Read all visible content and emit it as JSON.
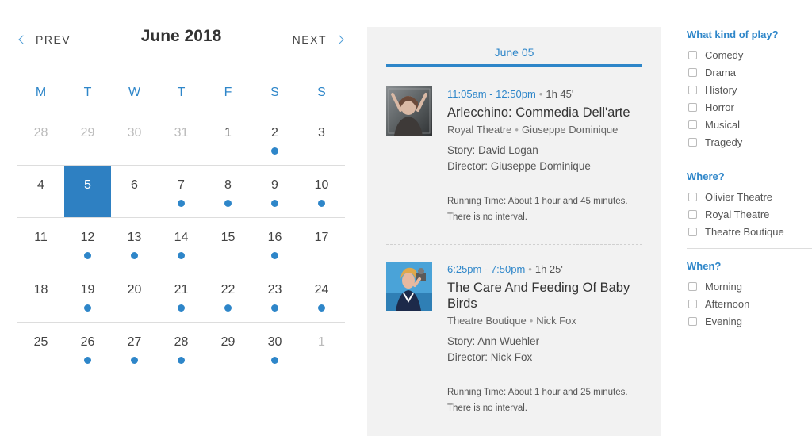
{
  "calendar": {
    "title": "June 2018",
    "prev_label": "PREV",
    "next_label": "NEXT",
    "weekdays": [
      "M",
      "T",
      "W",
      "T",
      "F",
      "S",
      "S"
    ],
    "weeks": [
      [
        {
          "day": "28",
          "muted": true,
          "dot": false
        },
        {
          "day": "29",
          "muted": true,
          "dot": false
        },
        {
          "day": "30",
          "muted": true,
          "dot": false
        },
        {
          "day": "31",
          "muted": true,
          "dot": false
        },
        {
          "day": "1",
          "muted": false,
          "dot": false
        },
        {
          "day": "2",
          "muted": false,
          "dot": true
        },
        {
          "day": "3",
          "muted": false,
          "dot": false
        }
      ],
      [
        {
          "day": "4",
          "muted": false,
          "dot": false
        },
        {
          "day": "5",
          "muted": false,
          "dot": false,
          "selected": true
        },
        {
          "day": "6",
          "muted": false,
          "dot": false
        },
        {
          "day": "7",
          "muted": false,
          "dot": true
        },
        {
          "day": "8",
          "muted": false,
          "dot": true
        },
        {
          "day": "9",
          "muted": false,
          "dot": true
        },
        {
          "day": "10",
          "muted": false,
          "dot": true
        }
      ],
      [
        {
          "day": "11",
          "muted": false,
          "dot": false
        },
        {
          "day": "12",
          "muted": false,
          "dot": true
        },
        {
          "day": "13",
          "muted": false,
          "dot": true
        },
        {
          "day": "14",
          "muted": false,
          "dot": true
        },
        {
          "day": "15",
          "muted": false,
          "dot": false
        },
        {
          "day": "16",
          "muted": false,
          "dot": true
        },
        {
          "day": "17",
          "muted": false,
          "dot": false
        }
      ],
      [
        {
          "day": "18",
          "muted": false,
          "dot": false
        },
        {
          "day": "19",
          "muted": false,
          "dot": true
        },
        {
          "day": "20",
          "muted": false,
          "dot": false
        },
        {
          "day": "21",
          "muted": false,
          "dot": true
        },
        {
          "day": "22",
          "muted": false,
          "dot": true
        },
        {
          "day": "23",
          "muted": false,
          "dot": true
        },
        {
          "day": "24",
          "muted": false,
          "dot": true
        }
      ],
      [
        {
          "day": "25",
          "muted": false,
          "dot": false
        },
        {
          "day": "26",
          "muted": false,
          "dot": true
        },
        {
          "day": "27",
          "muted": false,
          "dot": true
        },
        {
          "day": "28",
          "muted": false,
          "dot": true
        },
        {
          "day": "29",
          "muted": false,
          "dot": false
        },
        {
          "day": "30",
          "muted": false,
          "dot": true
        },
        {
          "day": "1",
          "muted": true,
          "dot": false
        }
      ]
    ]
  },
  "events_panel": {
    "date_tab": "June 05",
    "events": [
      {
        "time_range": "11:05am - 12:50pm",
        "duration": "1h 45'",
        "title": "Arlecchino: Commedia Dell'arte",
        "venue": "Royal Theatre",
        "person": "Giuseppe Dominique",
        "story": "Story: David Logan",
        "director": "Director: Giuseppe Dominique",
        "running_time": "Running Time: About 1 hour and 45 minutes.",
        "interval": "There is no interval."
      },
      {
        "time_range": "6:25pm - 7:50pm",
        "duration": "1h 25'",
        "title": "The Care And Feeding Of Baby Birds",
        "venue": "Theatre Boutique",
        "person": "Nick Fox",
        "story": "Story: Ann Wuehler",
        "director": "Director: Nick Fox",
        "running_time": "Running Time: About 1 hour and 25 minutes.",
        "interval": "There is no interval."
      }
    ]
  },
  "filters": {
    "kind": {
      "heading": "What kind of play?",
      "options": [
        "Comedy",
        "Drama",
        "History",
        "Horror",
        "Musical",
        "Tragedy"
      ]
    },
    "where": {
      "heading": "Where?",
      "options": [
        "Olivier Theatre",
        "Royal Theatre",
        "Theatre Boutique"
      ]
    },
    "when": {
      "heading": "When?",
      "options": [
        "Morning",
        "Afternoon",
        "Evening"
      ]
    }
  },
  "colors": {
    "accent": "#2e86c9",
    "selected_day": "#2e80c2",
    "panel_bg": "#f2f2f2"
  }
}
